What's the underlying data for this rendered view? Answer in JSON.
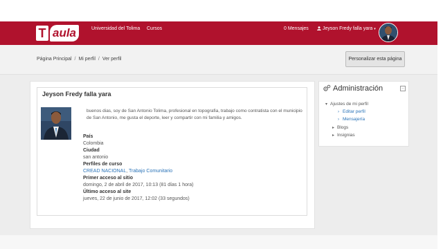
{
  "navbar": {
    "logo_letter": "T",
    "logo_text": "aula",
    "links": [
      "Universidad del Tolima",
      "Cursos"
    ],
    "messages": "0 Mensajes",
    "user_name": "Jeyson Fredy falla yara",
    "user_caret": "▾",
    "accent_color": "#b0122d"
  },
  "breadcrumb": {
    "items": [
      "Página Principal",
      "Mi perfil",
      "Ver perfil"
    ],
    "separator": "/"
  },
  "customize_button": "Personalizar esta página",
  "profile": {
    "name": "Jeyson Fredy falla yara",
    "description": "buenos dias, soy de San Antonio Tolima, profesional en topografia, trabajo como contratista con el municipio de San Antonio, me gusta el deporte, leer y compartir con mi familia y amigos.",
    "fields": {
      "country_label": "País",
      "country_value": "Colombia",
      "city_label": "Ciudad",
      "city_value": "san antonio",
      "courses_label": "Perfiles de curso",
      "course_1": "CREAD NACIONAL",
      "course_sep": ", ",
      "course_2": "Trabajo Comunitario",
      "first_access_label": "Primer acceso al sitio",
      "first_access_value": "domingo, 2 de abril de 2017, 10:13  (81 días 1 hora)",
      "last_access_label": "Último acceso al site",
      "last_access_value": "jueves, 22 de junio de 2017, 12:02  (33 segundos)"
    }
  },
  "admin": {
    "title": "Administración",
    "collapse": "–",
    "tree": {
      "root": "Ajustes de mi perfil",
      "edit": "Editar perfil",
      "messaging": "Mensajería",
      "blogs": "Blogs",
      "badges": "Insignias"
    }
  }
}
